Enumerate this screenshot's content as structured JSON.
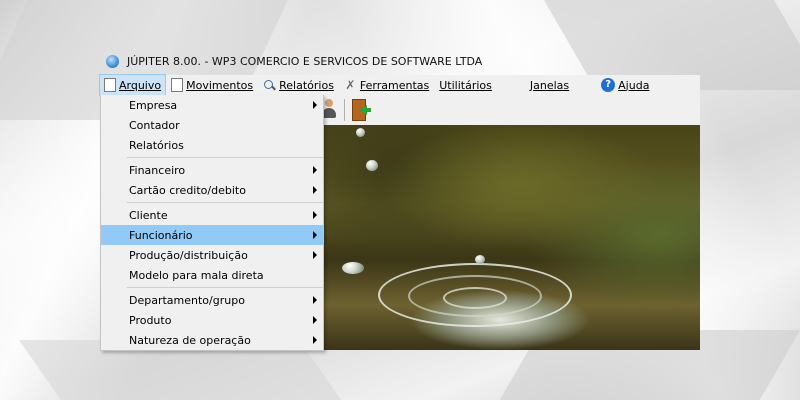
{
  "window": {
    "title": "JÚPITER 8.00. - WP3 COMERCIO E SERVICOS DE SOFTWARE LTDA"
  },
  "menubar": {
    "items": [
      {
        "label": "Arquivo",
        "icon": "document-icon"
      },
      {
        "label": "Movimentos",
        "icon": "document-icon"
      },
      {
        "label": "Relatórios",
        "icon": "magnifier-icon"
      },
      {
        "label": "Ferramentas",
        "icon": "tools-icon"
      },
      {
        "label": "Utilitários"
      },
      {
        "label": "Janelas"
      },
      {
        "label": "Ajuda",
        "icon": "help-icon",
        "icon_glyph": "?"
      }
    ]
  },
  "toolbar": {
    "buttons": [
      {
        "icon": "person-icon"
      },
      {
        "icon": "exit-door-icon"
      }
    ]
  },
  "arquivo_menu": {
    "items": [
      "Empresa",
      "Contador",
      "Relatórios",
      "Financeiro",
      "Cartão credito/debito",
      "Cliente",
      "Funcionário",
      "Produção/distribuição",
      "Modelo para mala direta",
      "Departamento/grupo",
      "Produto",
      "Natureza de operação"
    ],
    "selected": "Funcionário"
  },
  "colors": {
    "menu_bg": "#f0f0f0",
    "highlight": "#91c9f7",
    "active_menu": "#cce4f7"
  }
}
